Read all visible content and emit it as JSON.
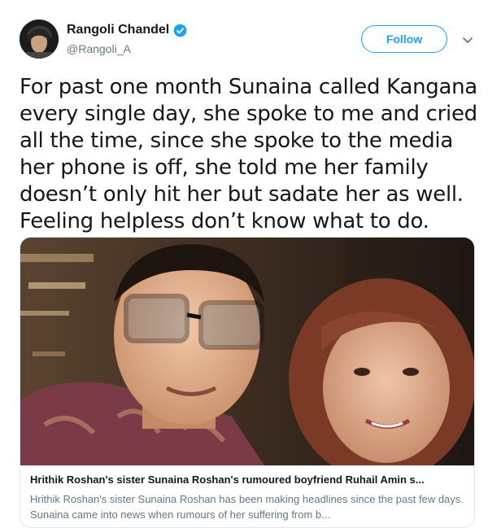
{
  "user": {
    "display_name": "Rangoli Chandel",
    "handle": "@Rangoli_A",
    "verified": true
  },
  "actions": {
    "follow_label": "Follow"
  },
  "tweet": {
    "text": "For past one month Sunaina called Kangana every single day, she spoke to me and cried all the time, since she spoke to the media her phone is off, she told me her family doesn’t only hit her but sadate her as well. Feeling helpless don’t know what to do."
  },
  "card": {
    "title": "Hrithik Roshan's sister Sunaina Roshan's rumoured boyfriend Ruhail Amin s...",
    "description": "Hrithik Roshan's sister Sunaina Roshan has been making headlines since the past few days. Sunaina came into news when rumours of her suffering from b..."
  },
  "colors": {
    "accent": "#1da1f2",
    "text": "#14171a",
    "secondary": "#657786",
    "border": "#e1e8ed"
  },
  "icons": {
    "verified": "verified-badge-icon",
    "caret": "chevron-down-icon"
  }
}
